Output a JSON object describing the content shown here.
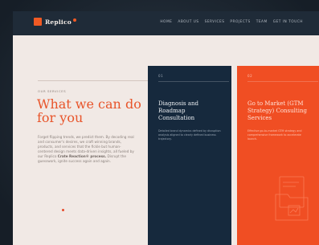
{
  "header": {
    "logo": "Replico",
    "nav": [
      "Home",
      "About Us",
      "Services",
      "Projects",
      "Team",
      "Get in Touch"
    ]
  },
  "intro": {
    "eyebrow": "Our Services",
    "headline": "What we can do for you",
    "body_pre": "Forget flipping trends, we predict them. By decoding real and consumer's desires, we craft winning brands, products, and services that the fickle but human-centered design meets data-driven insights, all fueled by our Replico ",
    "body_bold": "Crate Reaction® process.",
    "body_post": " Disrupt the guesswork, ignite success again and again."
  },
  "cards": [
    {
      "number": "01",
      "title": "Diagnosis and Roadmap Consultation",
      "desc": "Detailed brand dynamics defined by disruption analysis aligned to clearly defined business trajectory."
    },
    {
      "number": "02",
      "title": "Go to Market (GTM Strategy) Consulting Services",
      "desc": "Effective go-to-market GTM strategy and comprehensive framework to accelerate launch."
    }
  ],
  "colors": {
    "accent": "#f04e23",
    "navy": "#16293d",
    "page_bg": "#f1e9e5"
  }
}
